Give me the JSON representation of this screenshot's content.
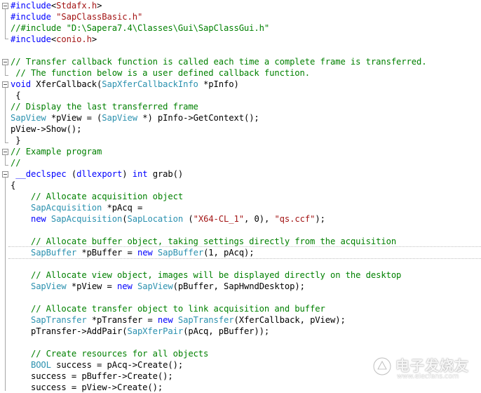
{
  "colors": {
    "keyword": "#0000ff",
    "string": "#a31515",
    "comment": "#008000",
    "type": "#2b91af",
    "plain": "#000000"
  },
  "lines": [
    [
      [
        "kw",
        "#include"
      ],
      [
        "pl",
        "<"
      ],
      [
        "str",
        "Stdafx.h"
      ],
      [
        "pl",
        ">"
      ]
    ],
    [
      [
        "kw",
        "#include"
      ],
      [
        "pl",
        " "
      ],
      [
        "str",
        "\"SapClassBasic.h\""
      ]
    ],
    [
      [
        "cm",
        "//#include \"D:\\Sapera7.4\\Classes\\Gui\\SapClassGui.h\""
      ]
    ],
    [
      [
        "kw",
        "#include"
      ],
      [
        "pl",
        "<"
      ],
      [
        "str",
        "conio.h"
      ],
      [
        "pl",
        ">"
      ]
    ],
    [],
    [
      [
        "cm",
        "// Transfer callback function is called each time a complete frame is transferred."
      ]
    ],
    [
      [
        "cm",
        " // The function below is a user defined callback function."
      ]
    ],
    [
      [
        "kw",
        "void"
      ],
      [
        "pl",
        " XferCallback("
      ],
      [
        "ty",
        "SapXferCallbackInfo"
      ],
      [
        "pl",
        " *"
      ],
      [
        "pl",
        "pInfo)"
      ]
    ],
    [
      [
        "pl",
        " {"
      ]
    ],
    [
      [
        "cm",
        "// Display the last transferred frame"
      ]
    ],
    [
      [
        "ty",
        "SapView"
      ],
      [
        "pl",
        " *pView = ("
      ],
      [
        "ty",
        "SapView"
      ],
      [
        "pl",
        " *) "
      ],
      [
        "pl",
        "pInfo->GetContext();"
      ]
    ],
    [
      [
        "pl",
        "pView->Show();"
      ]
    ],
    [
      [
        "pl",
        " }"
      ]
    ],
    [
      [
        "cm",
        "// Example program"
      ]
    ],
    [
      [
        "cm",
        "//"
      ]
    ],
    [
      [
        "pl",
        " "
      ],
      [
        "kw",
        "__declspec"
      ],
      [
        "pl",
        " ("
      ],
      [
        "kw",
        "dllexport"
      ],
      [
        "pl",
        ") "
      ],
      [
        "kw",
        "int"
      ],
      [
        "pl",
        " grab()"
      ]
    ],
    [
      [
        "pl",
        "{"
      ]
    ],
    [
      [
        "pl",
        "    "
      ],
      [
        "cm",
        "// Allocate acquisition object"
      ]
    ],
    [
      [
        "pl",
        "    "
      ],
      [
        "ty",
        "SapAcquisition"
      ],
      [
        "pl",
        " *pAcq ="
      ]
    ],
    [
      [
        "pl",
        "    "
      ],
      [
        "kw",
        "new"
      ],
      [
        "pl",
        " "
      ],
      [
        "ty",
        "SapAcquisition"
      ],
      [
        "pl",
        "("
      ],
      [
        "ty",
        "SapLocation"
      ],
      [
        "pl",
        " ("
      ],
      [
        "str",
        "\"X64-CL_1\""
      ],
      [
        "pl",
        ", 0), "
      ],
      [
        "str",
        "\"qs.ccf\""
      ],
      [
        "pl",
        ");"
      ]
    ],
    [],
    [
      [
        "pl",
        "    "
      ],
      [
        "cm",
        "// Allocate buffer object, taking settings directly from the acquisition"
      ]
    ],
    [
      [
        "pl",
        "    "
      ],
      [
        "ty",
        "SapBuffer"
      ],
      [
        "pl",
        " *pBuffer = "
      ],
      [
        "kw",
        "new"
      ],
      [
        "pl",
        " "
      ],
      [
        "ty",
        "SapBuffer"
      ],
      [
        "pl",
        "(1, pAcq);"
      ]
    ],
    [],
    [
      [
        "pl",
        "    "
      ],
      [
        "cm",
        "// Allocate view object, images will be displayed directly on the desktop"
      ]
    ],
    [
      [
        "pl",
        "    "
      ],
      [
        "ty",
        "SapView"
      ],
      [
        "pl",
        " *pView = "
      ],
      [
        "kw",
        "new"
      ],
      [
        "pl",
        " "
      ],
      [
        "ty",
        "SapView"
      ],
      [
        "pl",
        "(pBuffer, SapHwndDesktop);"
      ]
    ],
    [],
    [
      [
        "pl",
        "    "
      ],
      [
        "cm",
        "// Allocate transfer object to link acquisition and buffer"
      ]
    ],
    [
      [
        "pl",
        "    "
      ],
      [
        "ty",
        "SapTransfer"
      ],
      [
        "pl",
        " *pTransfer = "
      ],
      [
        "kw",
        "new"
      ],
      [
        "pl",
        " "
      ],
      [
        "ty",
        "SapTransfer"
      ],
      [
        "pl",
        "(XferCallback, pView);"
      ]
    ],
    [
      [
        "pl",
        "    pTransfer->AddPair("
      ],
      [
        "ty",
        "SapXferPair"
      ],
      [
        "pl",
        "(pAcq, pBuffer));"
      ]
    ],
    [],
    [
      [
        "pl",
        "    "
      ],
      [
        "cm",
        "// Create resources for all objects"
      ]
    ],
    [
      [
        "pl",
        "    "
      ],
      [
        "ty",
        "BOOL"
      ],
      [
        "pl",
        " success = pAcq->Create();"
      ]
    ],
    [
      [
        "pl",
        "    success = pBuffer->Create();"
      ]
    ],
    [
      [
        "pl",
        "    success = pView->Create();"
      ]
    ]
  ],
  "watermark": {
    "title": "电子发烧友",
    "url": "www.elecfans.com"
  }
}
